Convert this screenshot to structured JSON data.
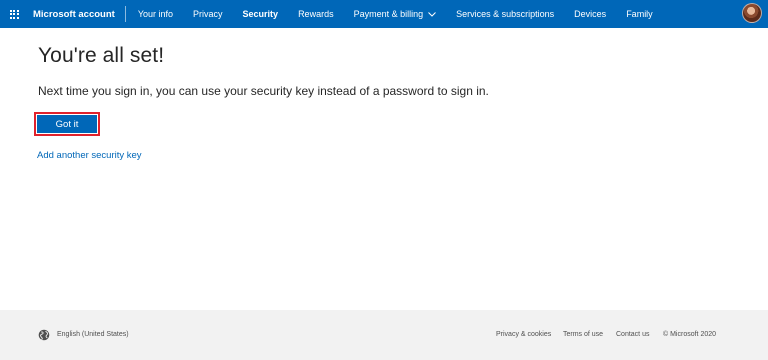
{
  "header": {
    "brand": "Microsoft account",
    "nav": [
      {
        "label": "Your info",
        "active": false
      },
      {
        "label": "Privacy",
        "active": false
      },
      {
        "label": "Security",
        "active": true
      },
      {
        "label": "Rewards",
        "active": false
      },
      {
        "label": "Payment & billing",
        "active": false,
        "has_dropdown": true
      },
      {
        "label": "Services & subscriptions",
        "active": false
      },
      {
        "label": "Devices",
        "active": false
      },
      {
        "label": "Family",
        "active": false
      }
    ],
    "icons": {
      "apps": "waffle-icon",
      "dropdown": "chevron-down-icon",
      "profile": "avatar"
    },
    "bar_color": "#0067b8"
  },
  "main": {
    "title": "You're all set!",
    "message": "Next time you sign in, you can use your security key instead of a password to sign in.",
    "primary_button": "Got it",
    "secondary_link": "Add another security key",
    "highlight_color": "#e0222c"
  },
  "footer": {
    "language": "English (United States)",
    "links": [
      "Privacy & cookies",
      "Terms of use",
      "Contact us"
    ],
    "copyright": "© Microsoft 2020",
    "icons": {
      "language": "globe-icon"
    }
  }
}
